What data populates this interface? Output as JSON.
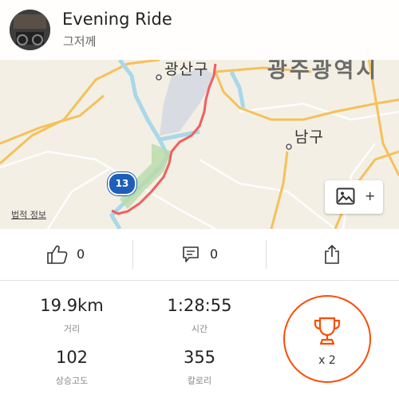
{
  "header": {
    "title": "Evening Ride",
    "subtitle": "그저께"
  },
  "map": {
    "labels": {
      "district_top": "광산구",
      "city": "광주광역시",
      "district_south": "남구"
    },
    "legal_link": "법적 정보",
    "route_badge": "13",
    "photo_button_plus": "+",
    "colors": {
      "route": "#f05f5f",
      "water": "#a8d8ea",
      "park": "#b8dba8",
      "road": "#f5c15a"
    }
  },
  "actions": {
    "kudos_count": "0",
    "comments_count": "0"
  },
  "stats": [
    {
      "value": "19.9km",
      "label": "거리"
    },
    {
      "value": "1:28:55",
      "label": "시간"
    },
    {
      "value": "102",
      "label": "상승고도"
    },
    {
      "value": "355",
      "label": "칼로리"
    }
  ],
  "achievements": {
    "count_label": "x 2"
  },
  "icons": [
    "thumbs-up-icon",
    "comment-icon",
    "share-icon",
    "photo-icon",
    "trophy-icon"
  ],
  "accent_color": "#fc4c02"
}
